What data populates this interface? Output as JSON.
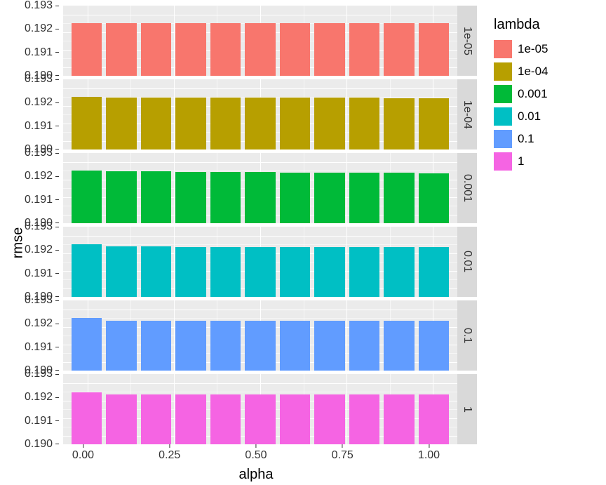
{
  "chart_data": {
    "type": "bar",
    "xlabel": "alpha",
    "ylabel": "rmse",
    "facet_var": "lambda",
    "x_ticks": [
      "0.00",
      "0.25",
      "0.50",
      "0.75",
      "1.00"
    ],
    "y_ticks": [
      "0.193",
      "0.192",
      "0.191",
      "0.190"
    ],
    "ylim": [
      0.1895,
      0.1935
    ],
    "x": [
      0.0,
      0.1,
      0.2,
      0.3,
      0.4,
      0.5,
      0.6,
      0.7,
      0.8,
      0.9,
      1.0
    ],
    "legend_title": "lambda",
    "legend": [
      {
        "label": "1e-05",
        "color": "#F8766D"
      },
      {
        "label": "1e-04",
        "color": "#B79F00"
      },
      {
        "label": "0.001",
        "color": "#00BA38"
      },
      {
        "label": "0.01",
        "color": "#00BFC4"
      },
      {
        "label": "0.1",
        "color": "#619CFF"
      },
      {
        "label": "1",
        "color": "#F564E3"
      }
    ],
    "facets": [
      {
        "lambda": "1e-05",
        "color": "#F8766D",
        "values": [
          0.19249,
          0.19249,
          0.19249,
          0.19249,
          0.19249,
          0.19249,
          0.19249,
          0.19249,
          0.19249,
          0.19249,
          0.19249
        ]
      },
      {
        "lambda": "1e-04",
        "color": "#B79F00",
        "values": [
          0.19249,
          0.19248,
          0.19248,
          0.19247,
          0.19247,
          0.19246,
          0.19246,
          0.19245,
          0.19245,
          0.19244,
          0.19244
        ]
      },
      {
        "lambda": "0.001",
        "color": "#00BA38",
        "values": [
          0.19249,
          0.19247,
          0.19246,
          0.19244,
          0.19243,
          0.19241,
          0.1924,
          0.19239,
          0.19238,
          0.19237,
          0.19236
        ]
      },
      {
        "lambda": "0.01",
        "color": "#00BFC4",
        "values": [
          0.19249,
          0.1924,
          0.19237,
          0.19235,
          0.19234,
          0.19234,
          0.19234,
          0.19234,
          0.19234,
          0.19234,
          0.19234
        ]
      },
      {
        "lambda": "0.1",
        "color": "#619CFF",
        "values": [
          0.19249,
          0.19234,
          0.19234,
          0.19234,
          0.19234,
          0.19234,
          0.19234,
          0.19234,
          0.19234,
          0.19234,
          0.19234
        ]
      },
      {
        "lambda": "1",
        "color": "#F564E3",
        "values": [
          0.19245,
          0.19234,
          0.19234,
          0.19234,
          0.19234,
          0.19234,
          0.19234,
          0.19234,
          0.19234,
          0.19234,
          0.19234
        ]
      }
    ]
  }
}
